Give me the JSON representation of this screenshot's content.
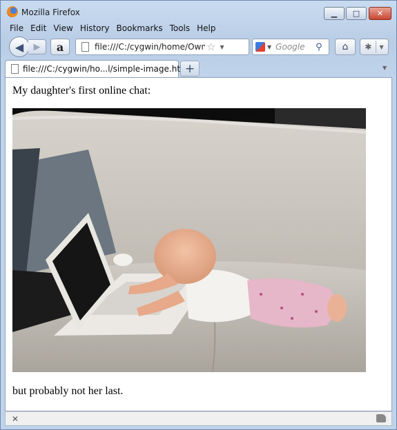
{
  "window": {
    "title": "Mozilla Firefox",
    "controls": {
      "minimize": "▭",
      "maximize": "□",
      "close": "✕"
    }
  },
  "menu": [
    "File",
    "Edit",
    "View",
    "History",
    "Bookmarks",
    "Tools",
    "Help"
  ],
  "toolbar": {
    "url": "file:///C:/cygwin/home/Owner",
    "search_placeholder": "Google",
    "amazon_label": "a"
  },
  "tabs": [
    {
      "label": "file:///C:/cygwin/ho...l/simple-image.html"
    }
  ],
  "page": {
    "line1": "My daughter's first online chat:",
    "line2": "but probably not her last."
  },
  "colors": {
    "accent": "#6f89ad",
    "close_button": "#c84633"
  }
}
